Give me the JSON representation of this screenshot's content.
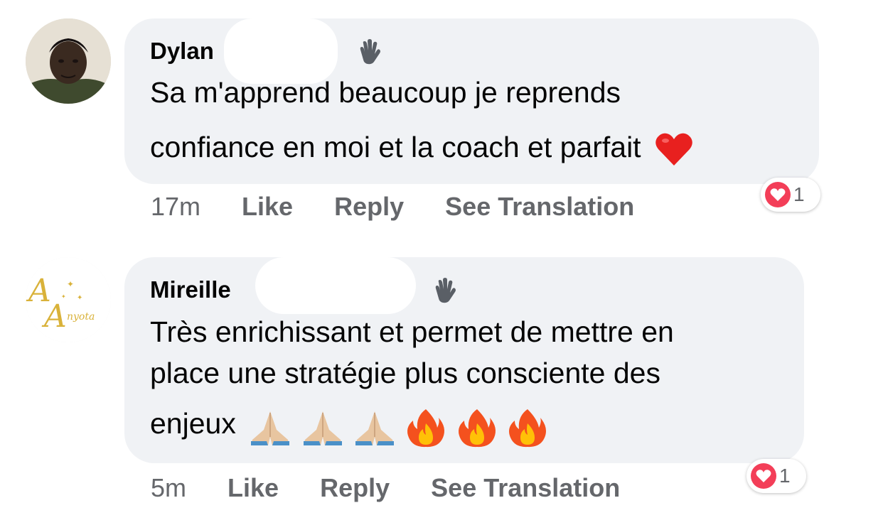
{
  "comments": [
    {
      "author": "Dylan",
      "text_lines": [
        "Sa m'apprend beaucoup je reprends",
        "confiance en moi et la coach et parfait"
      ],
      "trailing_emoji": "red-heart",
      "time": "17m",
      "actions": [
        "Like",
        "Reply",
        "See Translation"
      ],
      "reaction": {
        "type": "love",
        "count": "1"
      }
    },
    {
      "author": "Mireille",
      "avatar_logo_text": "AAnyota",
      "text_lines": [
        "Très enrichissant et permet de mettre en",
        "place une stratégie plus consciente des",
        "enjeux"
      ],
      "trailing_emoji": [
        "folded-hands",
        "folded-hands",
        "folded-hands",
        "fire",
        "fire",
        "fire"
      ],
      "time": "5m",
      "actions": [
        "Like",
        "Reply",
        "See Translation"
      ],
      "reaction": {
        "type": "love",
        "count": "1"
      }
    }
  ],
  "colors": {
    "bubble": "#f0f2f5",
    "action_text": "#65676b",
    "love": "#f33e58",
    "logo_gold": "#d9b23a"
  }
}
